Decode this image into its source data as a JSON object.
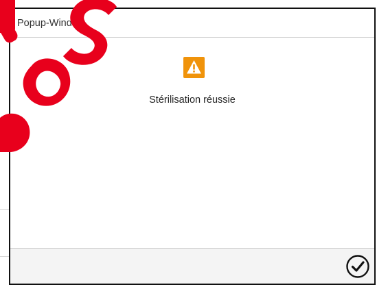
{
  "popup": {
    "title": "Popup-Window",
    "message": "Stérilisation réussie",
    "icon": "warning-icon",
    "confirm_icon": "checkmark-circle-icon"
  },
  "colors": {
    "warning_accent": "#f0930a",
    "watermark": "#e8001c",
    "border": "#111111",
    "footer_background": "#f4f4f4"
  }
}
